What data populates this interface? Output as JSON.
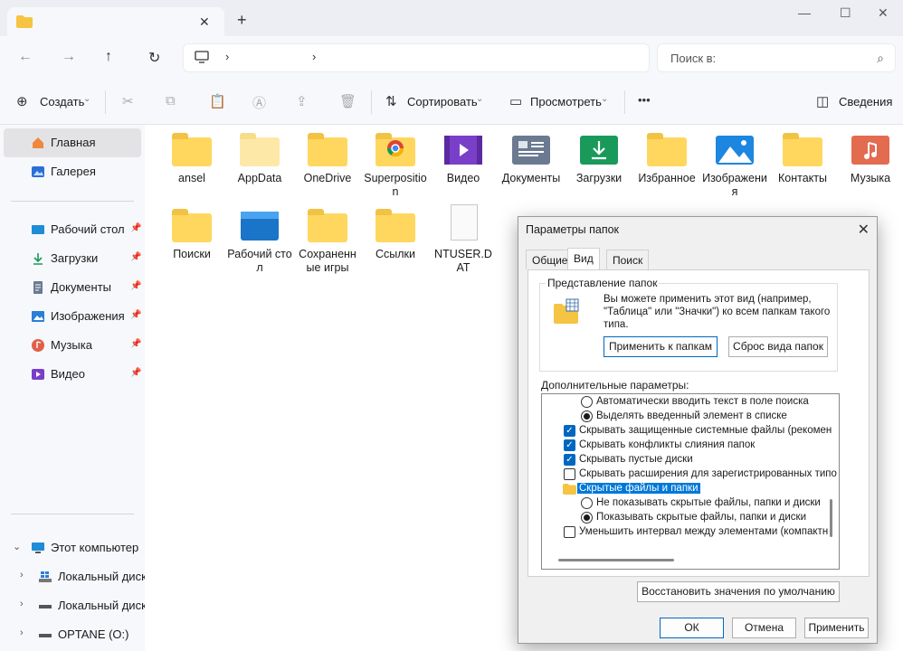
{
  "window": {
    "new_tab_icon": "plus-icon",
    "close_tab_icon": "close-icon"
  },
  "nav": {
    "search_placeholder": "Поиск в:"
  },
  "commandbar": {
    "create": "Создать",
    "sort": "Сортировать",
    "view": "Просмотреть",
    "more": "•••",
    "details": "Сведения"
  },
  "sidebar": {
    "items": [
      {
        "label": "Главная",
        "icon": "home-icon",
        "color": "#f0883e"
      },
      {
        "label": "Галерея",
        "icon": "gallery-icon",
        "color": "#2b6fd6"
      }
    ],
    "pinned": [
      {
        "label": "Рабочий стол",
        "icon": "desktop-icon",
        "color": "#1e8cd6"
      },
      {
        "label": "Загрузки",
        "icon": "download-icon",
        "color": "#1a9a5a"
      },
      {
        "label": "Документы",
        "icon": "documents-icon",
        "color": "#6b7a90"
      },
      {
        "label": "Изображения",
        "icon": "pictures-icon",
        "color": "#2b7fd6"
      },
      {
        "label": "Музыка",
        "icon": "music-icon",
        "color": "#e0604a"
      },
      {
        "label": "Видео",
        "icon": "video-icon",
        "color": "#7a3fc8"
      }
    ],
    "computer": "Этот компьютер",
    "drives": [
      "Локальный диск",
      "Локальный диск",
      "OPTANE (O:)"
    ]
  },
  "files": [
    {
      "name": "ansel",
      "type": "folder"
    },
    {
      "name": "AppData",
      "type": "folder-pale"
    },
    {
      "name": "OneDrive",
      "type": "folder"
    },
    {
      "name": "Superposition",
      "type": "folder-chrome"
    },
    {
      "name": "Видео",
      "type": "video"
    },
    {
      "name": "Документы",
      "type": "documents"
    },
    {
      "name": "Загрузки",
      "type": "downloads"
    },
    {
      "name": "Избранное",
      "type": "folder"
    },
    {
      "name": "Изображения",
      "type": "pictures"
    },
    {
      "name": "Контакты",
      "type": "folder"
    },
    {
      "name": "Музыка",
      "type": "music"
    },
    {
      "name": "Поиски",
      "type": "folder"
    },
    {
      "name": "Рабочий стол",
      "type": "desktop"
    },
    {
      "name": "Сохраненные игры",
      "type": "folder"
    },
    {
      "name": "Ссылки",
      "type": "folder"
    },
    {
      "name": "NTUSER.DAT",
      "type": "file"
    }
  ],
  "dialog": {
    "title": "Параметры папок",
    "tabs": [
      "Общие",
      "Вид",
      "Поиск"
    ],
    "group_title": "Представление папок",
    "group_text": "Вы можете применить этот вид (например, \"Таблица\" или \"Значки\") ко всем папкам такого типа.",
    "apply_btn": "Применить к папкам",
    "reset_btn": "Сброс вида папок",
    "advanced_label": "Дополнительные параметры:",
    "options": [
      {
        "kind": "radio",
        "checked": false,
        "indent": 2,
        "label": "Автоматически вводить текст в поле поиска"
      },
      {
        "kind": "radio",
        "checked": true,
        "indent": 2,
        "label": "Выделять введенный элемент в списке"
      },
      {
        "kind": "check",
        "checked": true,
        "indent": 1,
        "label": "Скрывать защищенные системные файлы (рекомен"
      },
      {
        "kind": "check",
        "checked": true,
        "indent": 1,
        "label": "Скрывать конфликты слияния папок"
      },
      {
        "kind": "check",
        "checked": true,
        "indent": 1,
        "label": "Скрывать пустые диски"
      },
      {
        "kind": "check",
        "checked": false,
        "indent": 1,
        "label": "Скрывать расширения для зарегистрированных типо"
      },
      {
        "kind": "folder",
        "checked": false,
        "indent": 1,
        "label": "Скрытые файлы и папки"
      },
      {
        "kind": "radio",
        "checked": false,
        "indent": 2,
        "label": "Не показывать скрытые файлы, папки и диски"
      },
      {
        "kind": "radio",
        "checked": true,
        "indent": 2,
        "label": "Показывать скрытые файлы, папки и диски"
      },
      {
        "kind": "check",
        "checked": false,
        "indent": 1,
        "label": "Уменьшить интервал между элементами (компактн"
      }
    ],
    "restore_btn": "Восстановить значения по умолчанию",
    "ok": "ОК",
    "cancel": "Отмена",
    "apply": "Применить"
  }
}
